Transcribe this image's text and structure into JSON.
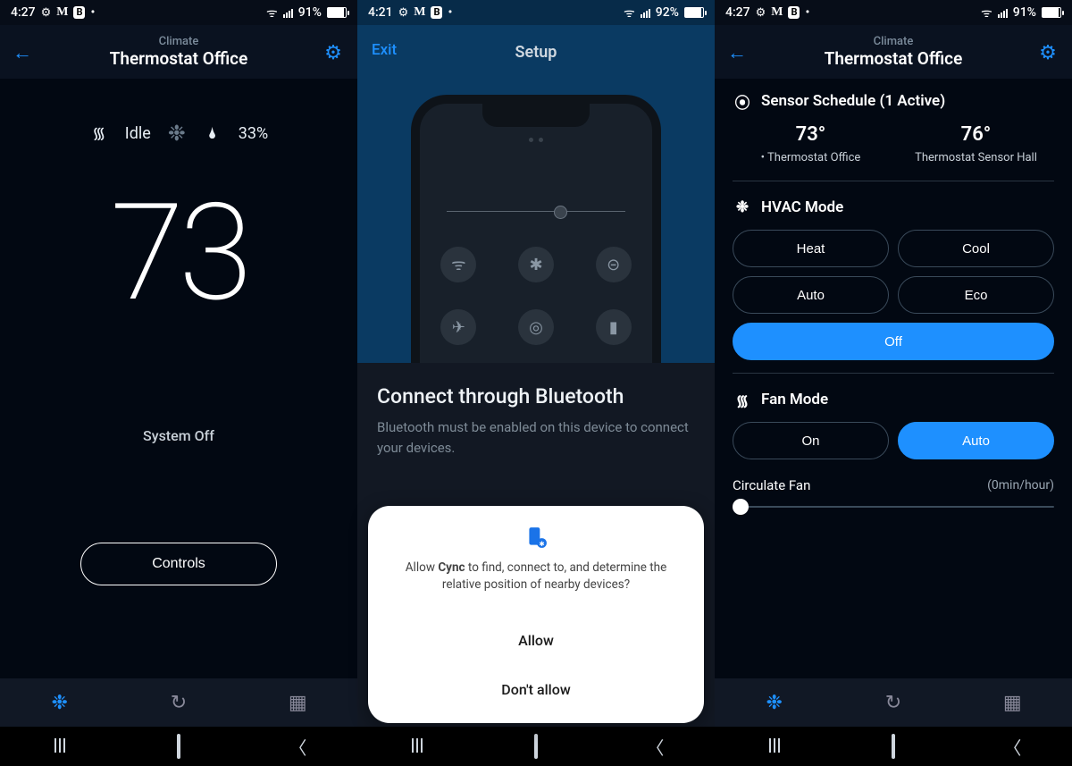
{
  "panel1": {
    "status_time": "4:27",
    "status_battery": "91%",
    "eyebrow": "Climate",
    "title": "Thermostat Office",
    "fan_state": "Idle",
    "humidity": "33%",
    "temperature": "73",
    "system_state": "System Off",
    "controls_button": "Controls"
  },
  "panel2": {
    "status_time": "4:21",
    "status_battery": "92%",
    "exit_label": "Exit",
    "title": "Setup",
    "heading": "Connect through Bluetooth",
    "body": "Bluetooth must be enabled on this device to connect your devices.",
    "perm_prefix": "Allow ",
    "perm_app": "Cync",
    "perm_suffix": " to find, connect to, and determine the relative position of nearby devices?",
    "perm_allow": "Allow",
    "perm_deny": "Don't allow"
  },
  "panel3": {
    "status_time": "4:27",
    "status_battery": "91%",
    "eyebrow": "Climate",
    "title": "Thermostat Office",
    "sensor_schedule_label": "Sensor Schedule (1 Active)",
    "sensors": [
      {
        "temp": "73°",
        "name": "• Thermostat Office"
      },
      {
        "temp": "76°",
        "name": "Thermostat Sensor Hall"
      }
    ],
    "hvac_label": "HVAC Mode",
    "hvac_modes": {
      "heat": "Heat",
      "cool": "Cool",
      "auto": "Auto",
      "eco": "Eco",
      "off": "Off"
    },
    "fan_label": "Fan Mode",
    "fan_modes": {
      "on": "On",
      "auto": "Auto"
    },
    "circulate_label": "Circulate Fan",
    "circulate_value": "(0min/hour)"
  },
  "icons": {
    "back": "←",
    "gear": "⚙",
    "fan": "᯾",
    "hvac": "❉",
    "drop": "🌢",
    "sensor": "⦿",
    "history": "↻",
    "calendar": "▦",
    "wifi": "ᯤ",
    "bt": "✱",
    "dnd": "⊝",
    "plane": "✈",
    "hotspot": "◎",
    "battery": "▮",
    "m": "M"
  }
}
